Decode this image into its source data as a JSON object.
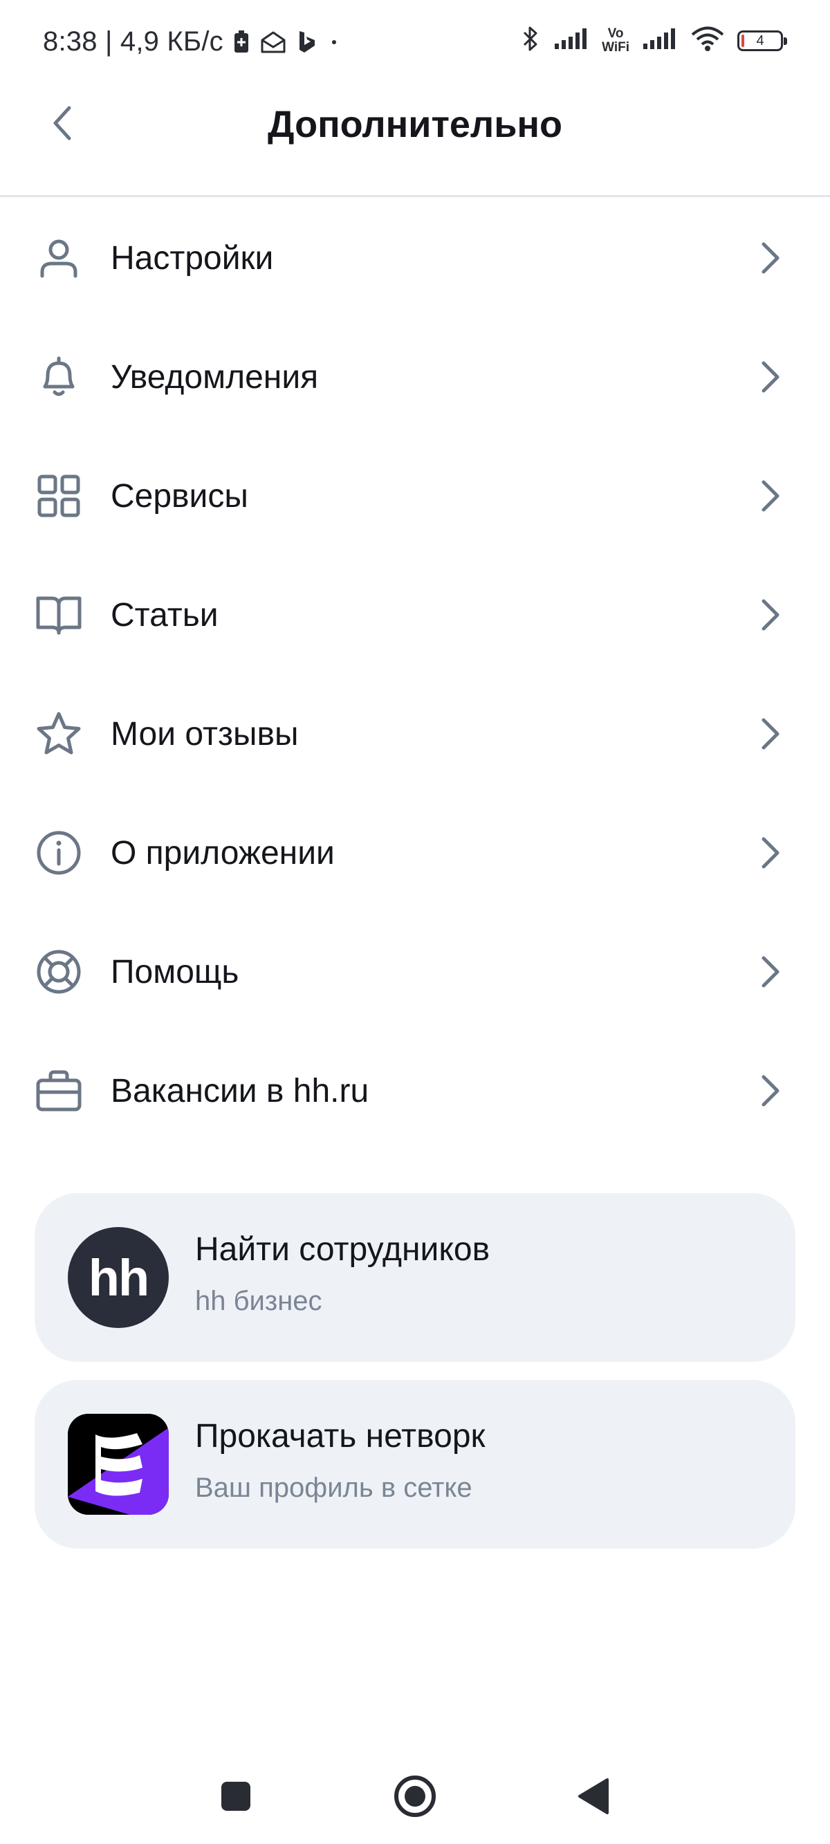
{
  "status_bar": {
    "time_speed": "8:38 | 4,9 КБ/с",
    "vowifi_top": "Vo",
    "vowifi_bottom": "WiFi",
    "battery_level": "4"
  },
  "header": {
    "title": "Дополнительно"
  },
  "menu": {
    "items": [
      {
        "label": "Настройки",
        "icon": "person-icon"
      },
      {
        "label": "Уведомления",
        "icon": "bell-icon"
      },
      {
        "label": "Сервисы",
        "icon": "grid-icon"
      },
      {
        "label": "Статьи",
        "icon": "book-icon"
      },
      {
        "label": "Мои отзывы",
        "icon": "star-icon"
      },
      {
        "label": "О приложении",
        "icon": "info-icon"
      },
      {
        "label": "Помощь",
        "icon": "lifebuoy-icon"
      },
      {
        "label": "Вакансии в hh.ru",
        "icon": "briefcase-icon"
      }
    ]
  },
  "promos": [
    {
      "title": "Найти сотрудников",
      "subtitle": "hh бизнес",
      "logo_text": "hh"
    },
    {
      "title": "Прокачать нетворк",
      "subtitle": "Ваш профиль в сетке"
    }
  ],
  "colors": {
    "icon": "#6b7686",
    "card_bg": "#eef2f7",
    "subtitle": "#7b8594",
    "hh_logo_bg": "#2a2d3a",
    "setka_purple": "#7a2cf5"
  }
}
